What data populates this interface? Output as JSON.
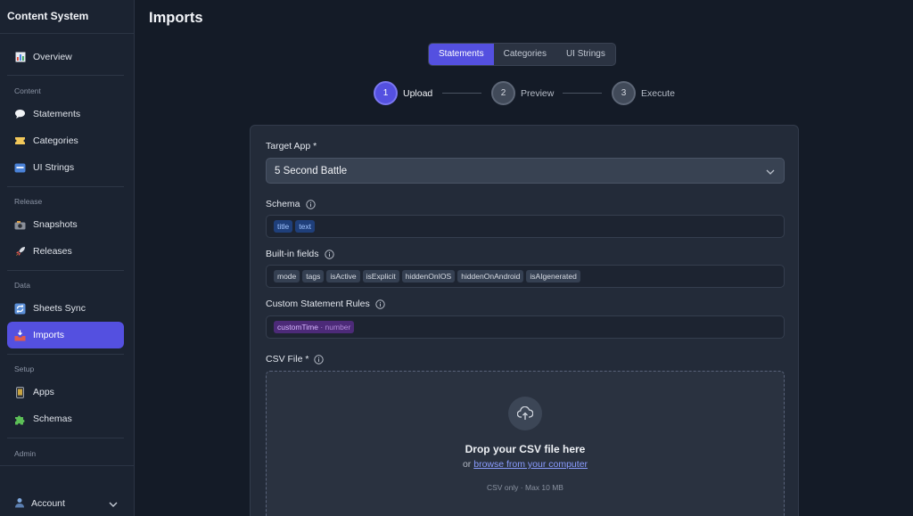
{
  "app": {
    "brand": "Content System",
    "page_title": "Imports"
  },
  "sidebar": {
    "top": [
      {
        "label": "Overview",
        "icon": "chart-icon"
      }
    ],
    "sections": [
      {
        "label": "Content",
        "items": [
          {
            "label": "Statements",
            "icon": "speech-bubble-icon"
          },
          {
            "label": "Categories",
            "icon": "ticket-icon"
          },
          {
            "label": "UI Strings",
            "icon": "abc-icon"
          }
        ]
      },
      {
        "label": "Release",
        "items": [
          {
            "label": "Snapshots",
            "icon": "camera-icon"
          },
          {
            "label": "Releases",
            "icon": "rocket-icon"
          }
        ]
      },
      {
        "label": "Data",
        "items": [
          {
            "label": "Sheets Sync",
            "icon": "sync-icon"
          },
          {
            "label": "Imports",
            "icon": "inbox-tray-icon",
            "active": true
          }
        ]
      },
      {
        "label": "Setup",
        "items": [
          {
            "label": "Apps",
            "icon": "phone-icon"
          },
          {
            "label": "Schemas",
            "icon": "puzzle-icon"
          }
        ]
      },
      {
        "label": "Admin",
        "items": []
      }
    ],
    "account": {
      "label": "Account",
      "icon": "user-icon"
    }
  },
  "tabs": [
    {
      "label": "Statements",
      "active": true
    },
    {
      "label": "Categories",
      "active": false
    },
    {
      "label": "UI Strings",
      "active": false
    }
  ],
  "stepper": [
    {
      "number": "1",
      "label": "Upload",
      "active": true
    },
    {
      "number": "2",
      "label": "Preview",
      "active": false
    },
    {
      "number": "3",
      "label": "Execute",
      "active": false
    }
  ],
  "form": {
    "target_app": {
      "label": "Target App *",
      "value": "5 Second Battle"
    },
    "schema": {
      "label": "Schema",
      "tags": [
        "title",
        "text"
      ]
    },
    "builtin": {
      "label": "Built-in fields",
      "tags": [
        "mode",
        "tags",
        "isActive",
        "isExplicit",
        "hiddenOnIOS",
        "hiddenOnAndroid",
        "isAIgenerated"
      ]
    },
    "custom_rules": {
      "label": "Custom Statement Rules",
      "tags": [
        {
          "name": "customTime",
          "type": "number"
        }
      ]
    },
    "csv": {
      "label": "CSV File *",
      "drop_title": "Drop your CSV file here",
      "drop_or": "or",
      "browse_link": "browse from your computer",
      "hint": "CSV only · Max 10 MB"
    }
  },
  "colors": {
    "accent": "#5450e0",
    "background": "#141b27",
    "sidebar": "#1b2331",
    "card": "#232b39"
  }
}
